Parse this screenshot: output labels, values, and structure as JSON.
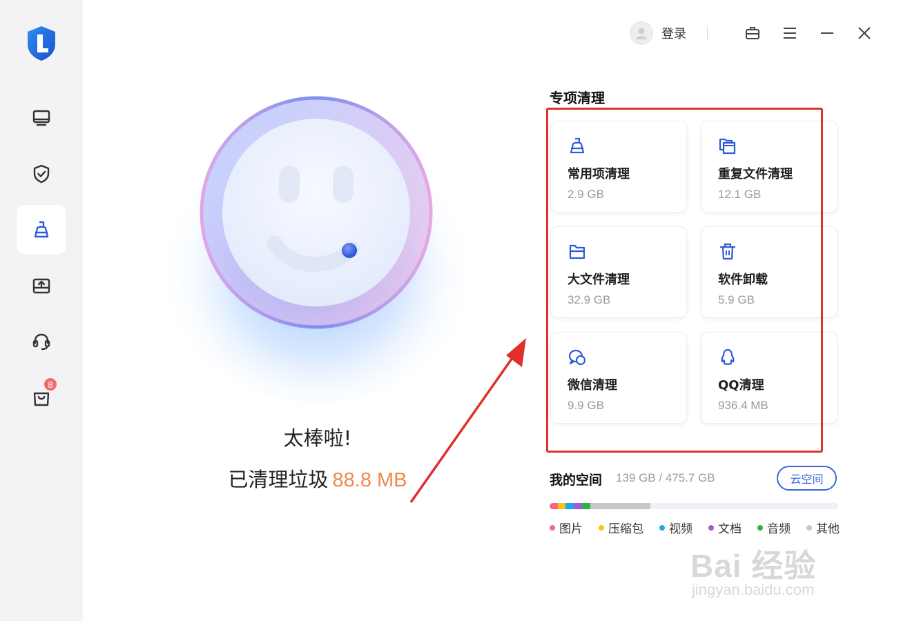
{
  "header": {
    "login_label": "登录"
  },
  "sidebar": {
    "items": [
      {
        "name": "computer",
        "active": false
      },
      {
        "name": "shield",
        "active": false
      },
      {
        "name": "clean",
        "active": true
      },
      {
        "name": "upload",
        "active": false
      },
      {
        "name": "support",
        "active": false
      },
      {
        "name": "store",
        "active": false,
        "badge": "8"
      }
    ]
  },
  "result": {
    "title": "太棒啦!",
    "cleaned_label": "已清理垃圾",
    "cleaned_amount": "88.8 MB"
  },
  "special": {
    "title": "专项清理",
    "cards": [
      {
        "icon": "broom-icon",
        "label": "常用项清理",
        "size": "2.9 GB"
      },
      {
        "icon": "duplicate-files-icon",
        "label": "重复文件清理",
        "size": "12.1 GB"
      },
      {
        "icon": "folder-icon",
        "label": "大文件清理",
        "size": "32.9 GB"
      },
      {
        "icon": "trash-icon",
        "label": "软件卸载",
        "size": "5.9 GB"
      },
      {
        "icon": "wechat-icon",
        "label": "微信清理",
        "size": "9.9 GB"
      },
      {
        "icon": "qq-icon",
        "label": "QQ清理",
        "size": "936.4 MB"
      }
    ]
  },
  "space": {
    "title": "我的空间",
    "usage": "139 GB / 475.7 GB",
    "cloud_button": "云空间",
    "used_fraction": 0.35,
    "legend": [
      {
        "label": "图片",
        "color": "#f06a86"
      },
      {
        "label": "压缩包",
        "color": "#f6c51a"
      },
      {
        "label": "视频",
        "color": "#1fa8e8"
      },
      {
        "label": "文档",
        "color": "#a25ad8"
      },
      {
        "label": "音频",
        "color": "#2bb24c"
      },
      {
        "label": "其他",
        "color": "#c8c8c8"
      }
    ]
  },
  "watermark": {
    "brand": "Bai 经验",
    "url": "jingyan.baidu.com"
  },
  "colors": {
    "accent": "#3a64d8",
    "highlight": "#f0894a",
    "annotation": "#e0302a"
  }
}
